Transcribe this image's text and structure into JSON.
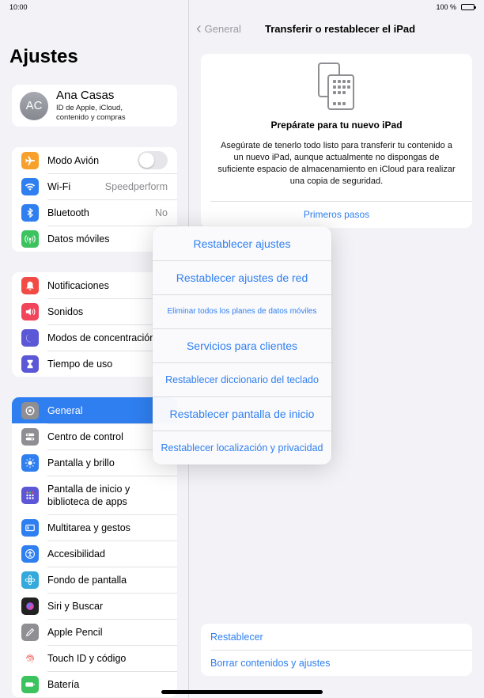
{
  "status": {
    "time": "10:00",
    "battery": "100 %"
  },
  "sidebar": {
    "title": "Ajustes",
    "profile": {
      "initials": "AC",
      "name": "Ana Casas",
      "subtitle": "ID de Apple, iCloud, contenido y compras"
    },
    "group1": [
      {
        "label": "Modo Avión",
        "icon": "airplane-icon",
        "color": "#f7a12c"
      },
      {
        "label": "Wi-Fi",
        "value": "Speedperform",
        "icon": "wifi-icon",
        "color": "#2f7ff0"
      },
      {
        "label": "Bluetooth",
        "value": "No",
        "icon": "bluetooth-icon",
        "color": "#2f7ff0"
      },
      {
        "label": "Datos móviles",
        "icon": "antenna-icon",
        "color": "#3cc35f"
      }
    ],
    "group2": [
      {
        "label": "Notificaciones",
        "icon": "bell-icon",
        "color": "#f24b45"
      },
      {
        "label": "Sonidos",
        "icon": "speaker-icon",
        "color": "#f2445b"
      },
      {
        "label": "Modos de concentración",
        "icon": "moon-icon",
        "color": "#5b57d6"
      },
      {
        "label": "Tiempo de uso",
        "icon": "hourglass-icon",
        "color": "#5b57d6"
      }
    ],
    "group3": [
      {
        "label": "General",
        "icon": "gear-icon",
        "color": "#8e8e93"
      },
      {
        "label": "Centro de control",
        "icon": "switches-icon",
        "color": "#8e8e93"
      },
      {
        "label": "Pantalla y brillo",
        "icon": "sun-icon",
        "color": "#2f7ff0"
      },
      {
        "label": "Pantalla de inicio y biblioteca de apps",
        "icon": "grid-icon",
        "color": "#5b57d6"
      },
      {
        "label": "Multitarea y gestos",
        "icon": "multitask-icon",
        "color": "#2f7ff0"
      },
      {
        "label": "Accesibilidad",
        "icon": "accessibility-icon",
        "color": "#2f7ff0"
      },
      {
        "label": "Fondo de pantalla",
        "icon": "flower-icon",
        "color": "#34aadc"
      },
      {
        "label": "Siri y Buscar",
        "icon": "siri-icon",
        "color": "#222222"
      },
      {
        "label": "Apple Pencil",
        "icon": "pencil-icon",
        "color": "#8e8e93"
      },
      {
        "label": "Touch ID y código",
        "icon": "fingerprint-icon",
        "color": "#f24b45"
      },
      {
        "label": "Batería",
        "icon": "battery-icon",
        "color": "#3cc35f"
      }
    ]
  },
  "main": {
    "back_label": "General",
    "title": "Transferir o restablecer el iPad",
    "card": {
      "heading": "Prepárate para tu nuevo iPad",
      "body": "Asegúrate de tenerlo todo listo para transferir tu contenido a un nuevo iPad, aunque actualmente no dispongas de suficiente espacio de almacenamiento en iCloud para realizar una copia de seguridad.",
      "link": "Primeros pasos"
    },
    "bottom": [
      "Restablecer",
      "Borrar contenidos y ajustes"
    ]
  },
  "popup": {
    "items": [
      "Restablecer ajustes",
      "Restablecer ajustes de red",
      "Eliminar todos los planes de datos móviles",
      "Servicios para clientes",
      "Restablecer diccionario del teclado",
      "Restablecer pantalla de inicio",
      "Restablecer localización y privacidad"
    ]
  }
}
